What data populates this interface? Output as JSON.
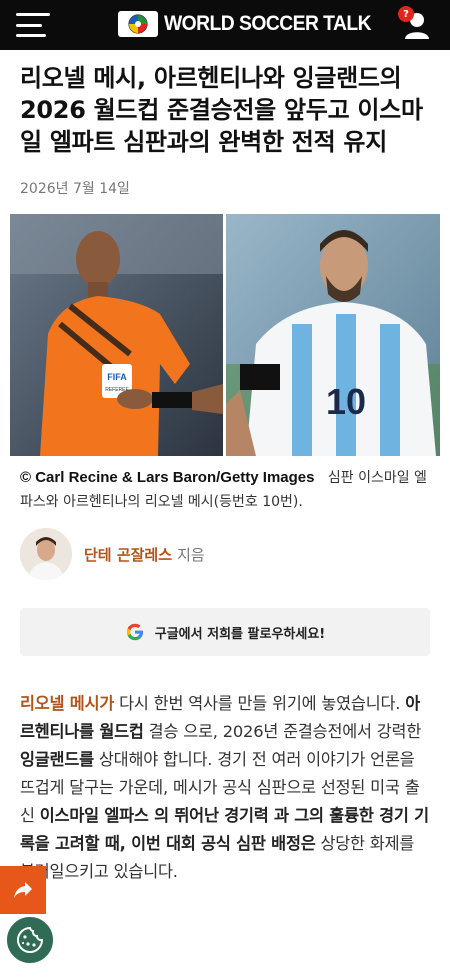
{
  "header": {
    "logo_text": "WORLD SOCCER TALK",
    "notification_badge": "?",
    "colors": {
      "bar": "#0b0b0b",
      "badge": "#e0261b"
    }
  },
  "article": {
    "headline": "리오넬 메시, 아르헨티나와 잉글랜드의 2026 월드컵 준결승전을 앞두고 이스마일 엘파트 심판과의 완벽한 전적 유지",
    "date": "2026년 7월 14일",
    "photo": {
      "left_subject": "referee",
      "left_badge": "FIFA",
      "left_badge_sub": "REFEREE",
      "right_subject": "player",
      "right_number": "10"
    },
    "caption_credit": "© Carl Recine & Lars Baron/Getty Images",
    "caption_text": "심판 이스마일 엘파스와 아르헨티나의 리오넬 메시(등번호 10번).",
    "author_name": "단테 곤잘레스",
    "author_suffix": "지음",
    "google_follow": "구글에서 저희를 팔로우하세요!",
    "body": {
      "p1_link": "리오넬 메시가",
      "p1_a": " 다시 한번 역사를 만들 위기에 놓였습니다. ",
      "p1_b1": "아르헨티나를 월드컵",
      "p1_c": " 결승 으로, 2026년 준결승전에서 강력한 ",
      "p1_b2": "잉글랜드를",
      "p1_d": " 상대해야 합니다. 경기 전 여러 이야기가 언론을 뜨겁게 달구는 가운데, 메시가 공식 심판으로 선정된 미국 출신 ",
      "p1_b3": "이스마일 엘파스 의 뛰어난 경기력 과 그의 훌륭한 경기 기록을 고려할 때, 이번 대회 공식 심판 배정은",
      "p1_e": " 상당한 화제를 불러일으키고 있습니다."
    }
  },
  "accent_color": "#b2541a",
  "share_color": "#e8571a",
  "cookie_color": "#2f6b55"
}
